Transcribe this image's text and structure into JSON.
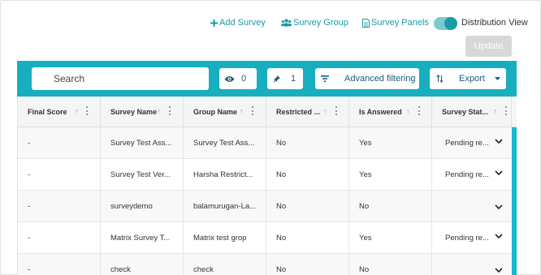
{
  "header": {
    "add_survey": "Add Survey",
    "survey_group": "Survey Group",
    "survey_panels": "Survey Panels",
    "distribution_view": "Distribution View",
    "update": "Update"
  },
  "toolbar": {
    "search_placeholder": "Search",
    "visible_count": "0",
    "pinned_count": "1",
    "advanced_filtering": "Advanced filtering",
    "export": "Export"
  },
  "colors": {
    "accent": "#17aebf",
    "link": "#1a9ba6"
  },
  "table": {
    "columns": [
      {
        "label": "Final Score"
      },
      {
        "label": "Survey Name"
      },
      {
        "label": "Group Name"
      },
      {
        "label": "Restricted ..."
      },
      {
        "label": "Is Answered"
      },
      {
        "label": "Survey Stat..."
      }
    ],
    "rows": [
      {
        "final_score": "-",
        "survey_name": "Survey Test Ass...",
        "group_name": "Survey Test Ass...",
        "restricted": "No",
        "answered": "Yes",
        "status": "Pending re..."
      },
      {
        "final_score": "-",
        "survey_name": "Survey Test Ver...",
        "group_name": "Harsha Restrict...",
        "restricted": "No",
        "answered": "Yes",
        "status": "Pending re..."
      },
      {
        "final_score": "-",
        "survey_name": "surveydemo",
        "group_name": "balamurugan-La...",
        "restricted": "No",
        "answered": "No",
        "status": ""
      },
      {
        "final_score": "-",
        "survey_name": "Matrix Survey T...",
        "group_name": "Matrix test grop",
        "restricted": "No",
        "answered": "Yes",
        "status": "Pending re..."
      },
      {
        "final_score": "-",
        "survey_name": "check",
        "group_name": "check",
        "restricted": "No",
        "answered": "No",
        "status": ""
      }
    ]
  }
}
